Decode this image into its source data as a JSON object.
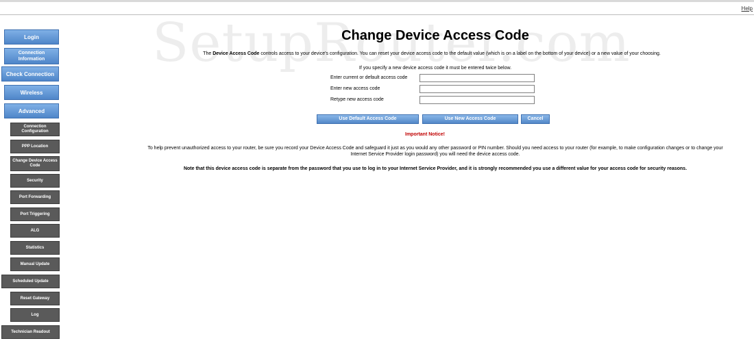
{
  "top_bar": {
    "help_label": "Help"
  },
  "watermark": "SetupRouter.com",
  "sidebar": {
    "main_items": {
      "login": "Login",
      "connection_information": "Connection Information",
      "check_connection": "Check Connection",
      "wireless": "Wireless",
      "advanced": "Advanced"
    },
    "sub_items": {
      "connection_configuration": "Connection Configuration",
      "ppp_location": "PPP Location",
      "change_device_access_code": "Change Device Access Code",
      "security": "Security",
      "port_forwarding": "Port Forwarding",
      "port_triggering": "Port Triggering",
      "alg": "ALG",
      "statistics": "Statistics",
      "manual_update": "Manual Update",
      "scheduled_update": "Scheduled Update",
      "reset_gateway": "Reset Gateway",
      "log": "Log",
      "technician_readout": "Technician Readout"
    }
  },
  "main": {
    "title": "Change Device Access Code",
    "intro_prefix": "The ",
    "intro_bold": "Device Access Code",
    "intro_suffix": " controls access to your device's configuration. You can reset your device access code to the default value (which is on a label on the bottom of your device) or a new value of your choosing.",
    "form_note": "If you specify a new device access code it must be entered twice below.",
    "form": {
      "current_label": "Enter current or default access code",
      "current_value": "",
      "new_label": "Enter new access code",
      "new_value": "",
      "retype_label": "Retype new access code",
      "retype_value": ""
    },
    "buttons": {
      "use_default": "Use Default Access Code",
      "use_new": "Use New Access Code",
      "cancel": "Cancel"
    },
    "notice_title": "Important Notice!",
    "notice_body": "To help prevent unauthorized access to your router, be sure you record your Device Access Code and safeguard it just as you would any other password or PIN number. Should you need access to your router (for example, to make configuration changes or to change your Internet Service Provider login password) you will need the device access code.",
    "notice_strong": "Note that this device access code is separate from the password that you use to log in to your Internet Service Provider, and it is strongly recommended you use a different value for your access code for security reasons."
  }
}
